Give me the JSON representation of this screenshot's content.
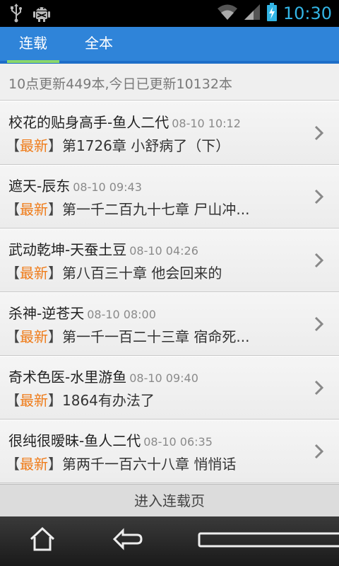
{
  "status_bar": {
    "time": "10:30"
  },
  "tabs": [
    {
      "label": "连载",
      "active": true
    },
    {
      "label": "全本",
      "active": false
    }
  ],
  "summary": "10点更新449本,今日已更新10132本",
  "list": [
    {
      "title": "校花的贴身高手-鱼人二代",
      "time": "08-10 10:12",
      "tag": "最新",
      "chapter": "第1726章 小舒病了（下）"
    },
    {
      "title": "遮天-辰东",
      "time": "08-10 09:43",
      "tag": "最新",
      "chapter": "第一千二百九十七章 尸山冲..."
    },
    {
      "title": "武动乾坤-天蚕土豆",
      "time": "08-10 04:26",
      "tag": "最新",
      "chapter": "第八百三十章 他会回来的"
    },
    {
      "title": "杀神-逆苍天",
      "time": "08-10 08:00",
      "tag": "最新",
      "chapter": "第一千一百二十三章 宿命死..."
    },
    {
      "title": "奇术色医-水里游鱼",
      "time": "08-10 09:40",
      "tag": "最新",
      "chapter": "1864有办法了"
    },
    {
      "title": "很纯很暧昧-鱼人二代",
      "time": "08-10 06:35",
      "tag": "最新",
      "chapter": "第两千一百六十八章 悄悄话"
    }
  ],
  "bracket_open": "【",
  "bracket_close": "】",
  "more_button": "进入连载页",
  "colors": {
    "tab_bar": "#2f84d9",
    "tab_indicator": "#8bd86a",
    "tag": "#ef7b18",
    "clock": "#33b5e5"
  }
}
